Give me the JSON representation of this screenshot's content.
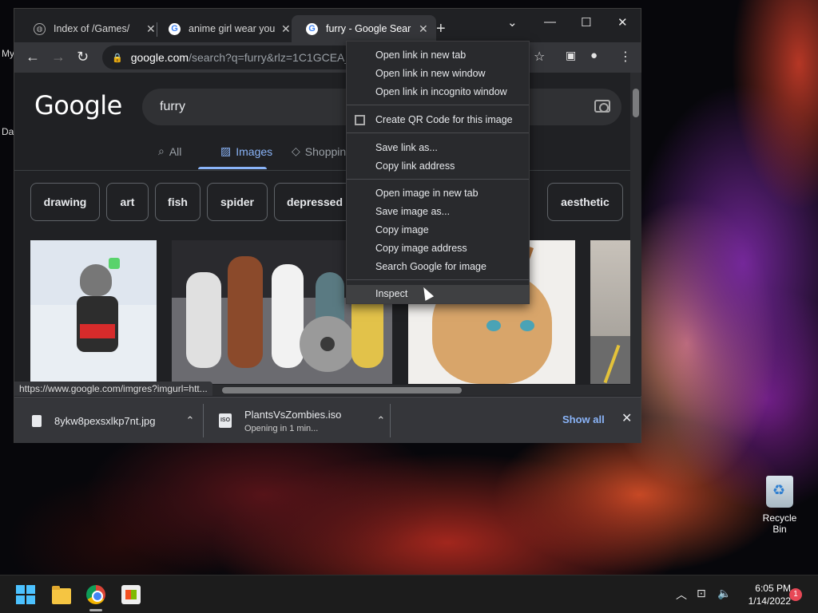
{
  "desktop": {
    "left_fragments": [
      "My",
      "Da"
    ],
    "recycle_bin_label": "Recycle Bin"
  },
  "browser": {
    "tabs": [
      {
        "title": "Index of /Games/",
        "icon": "globe-icon",
        "active": false
      },
      {
        "title": "anime girl wear you",
        "icon": "google-g-icon",
        "active": false
      },
      {
        "title": "furry - Google Sear",
        "icon": "google-g-icon",
        "active": true
      }
    ],
    "window_controls": {
      "tabsearch": "⌄",
      "minimize": "—",
      "maximize": "☐",
      "close": "✕"
    },
    "toolbar": {
      "url_host": "google.com",
      "url_path": "/search?q=furry&rlz=1C1GCEA_"
    },
    "page": {
      "logo": "Google",
      "query": "furry",
      "search_tabs": [
        {
          "label": "All",
          "icon": "search-icon",
          "active": false
        },
        {
          "label": "Images",
          "icon": "image-icon",
          "active": true
        },
        {
          "label": "Shopping",
          "icon": "tag-icon",
          "active": false
        }
      ],
      "chips": [
        "drawing",
        "art",
        "fish",
        "spider",
        "depressed",
        "aesthetic"
      ]
    },
    "status_url": "https://www.google.com/imgres?imgurl=htt...",
    "downloads": [
      {
        "name": "8ykw8pexsxlkp7nt.jpg",
        "status": ""
      },
      {
        "name": "PlantsVsZombies.iso",
        "status": "Opening in 1 min..."
      }
    ],
    "downloads_show_all": "Show all"
  },
  "context_menu": {
    "groups": [
      [
        "Open link in new tab",
        "Open link in new window",
        "Open link in incognito window"
      ],
      [
        "Create QR Code for this image"
      ],
      [
        "Save link as...",
        "Copy link address"
      ],
      [
        "Open image in new tab",
        "Save image as...",
        "Copy image",
        "Copy image address",
        "Search Google for image"
      ],
      [
        "Inspect"
      ]
    ],
    "hovered": "Inspect"
  },
  "taskbar": {
    "time": "6:05 PM",
    "date": "1/14/2022",
    "notification_count": "1"
  },
  "colors": {
    "accent_blue": "#8ab4f8",
    "surface": "#202124",
    "toolbar": "#35363a"
  }
}
